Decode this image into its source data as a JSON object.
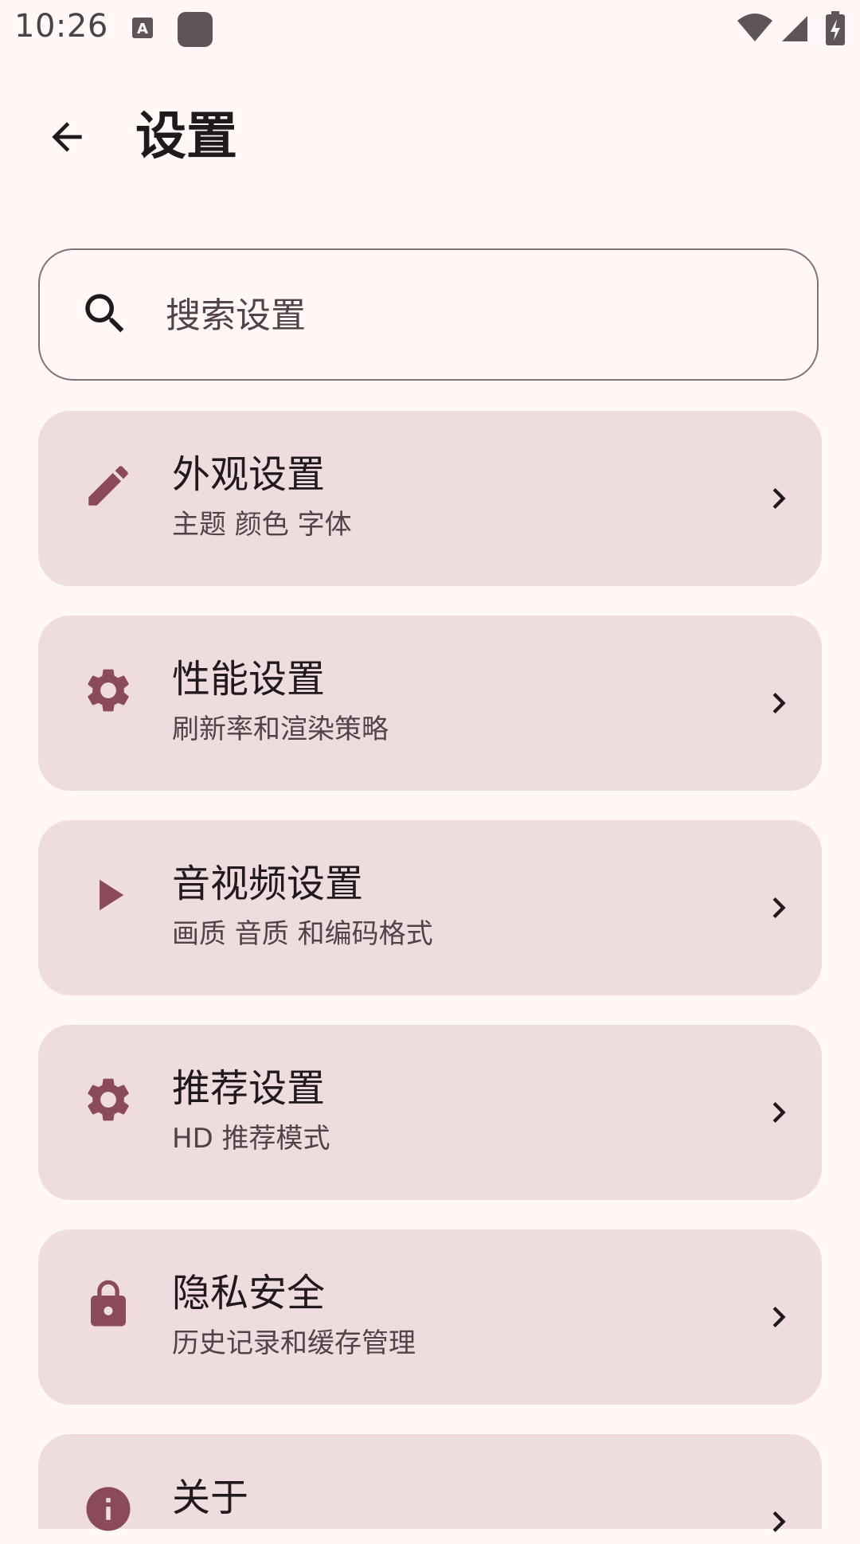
{
  "status_bar": {
    "time": "10:26",
    "left_icons": [
      "text-a-icon",
      "app-square-icon"
    ],
    "right_icons": [
      "wifi-icon",
      "cellular-signal-icon",
      "battery-charging-icon"
    ]
  },
  "header": {
    "back_icon": "arrow-left-icon",
    "title": "设置"
  },
  "search": {
    "icon": "search-icon",
    "placeholder": "搜索设置",
    "value": ""
  },
  "settings_items": [
    {
      "icon": "pencil-icon",
      "title": "外观设置",
      "subtitle": "主题 颜色 字体"
    },
    {
      "icon": "gear-icon",
      "title": "性能设置",
      "subtitle": "刷新率和渲染策略"
    },
    {
      "icon": "play-icon",
      "title": "音视频设置",
      "subtitle": "画质 音质 和编码格式"
    },
    {
      "icon": "gear-icon",
      "title": "推荐设置",
      "subtitle": "HD 推荐模式"
    },
    {
      "icon": "lock-icon",
      "title": "隐私安全",
      "subtitle": "历史记录和缓存管理"
    },
    {
      "icon": "info-icon",
      "title": "关于",
      "subtitle": ""
    }
  ],
  "colors": {
    "background": "#FFF8F7",
    "card": "#EFDCDF",
    "accent": "#8A4A5C",
    "text_primary": "#201A1B",
    "text_secondary": "#524346",
    "outline": "#7E7577"
  }
}
